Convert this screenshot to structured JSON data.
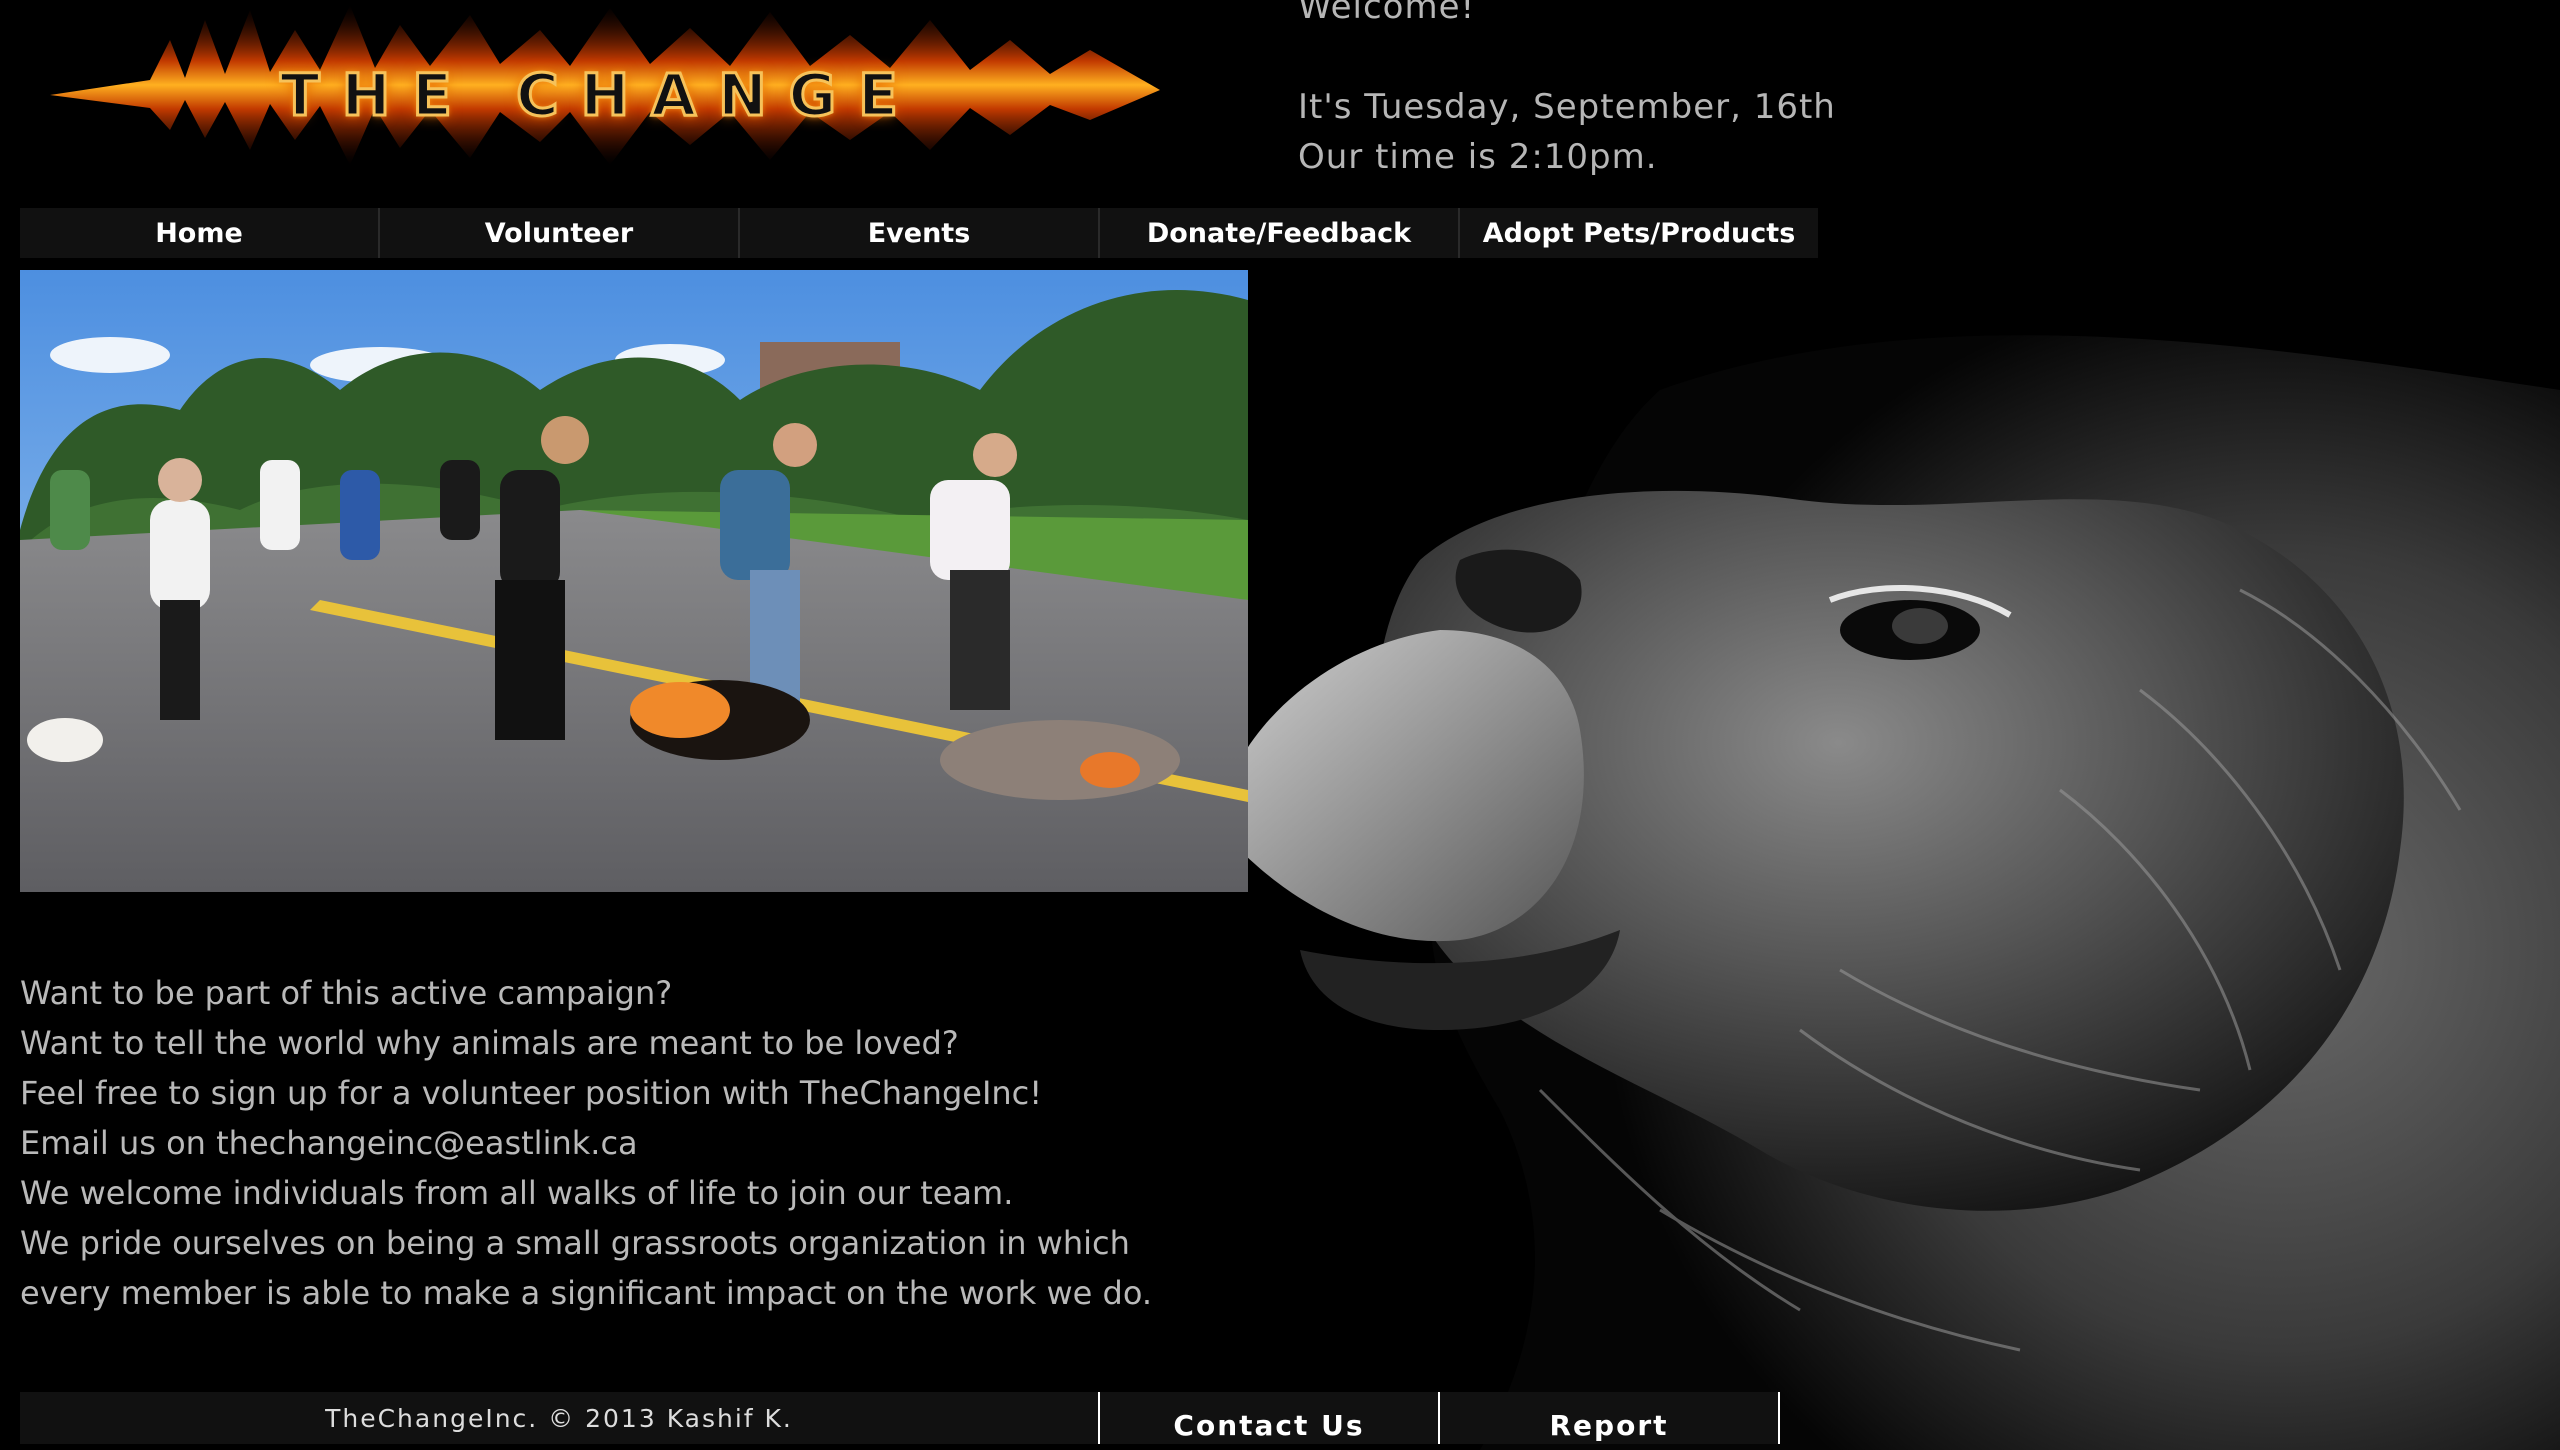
{
  "logo": {
    "text": "THE CHANGE"
  },
  "welcome": {
    "heading": "Welcome!",
    "date_line": "It's Tuesday, September, 16th",
    "time_line": "Our time is 2:10pm."
  },
  "nav": {
    "items": [
      {
        "label": "Home"
      },
      {
        "label": "Volunteer"
      },
      {
        "label": "Events"
      },
      {
        "label": "Donate/Feedback"
      },
      {
        "label": "Adopt Pets/Products"
      }
    ]
  },
  "main": {
    "paragraphs": [
      "Want to be part of this active campaign?",
      "Want to tell the world why animals are meant to be loved?",
      "Feel free to sign up for a volunteer position with TheChangeInc!",
      "Email us on thechangeinc@eastlink.ca",
      "We welcome individuals from all walks of life to join our team.",
      "We pride ourselves on being a small grassroots organization in which",
      "every member is able to make a significant impact on the work we do."
    ]
  },
  "footer": {
    "copyright": "TheChangeInc. © 2013 Kashif K.",
    "contact_label": "Contact Us",
    "report_label": "Report"
  },
  "colors": {
    "background": "#000000",
    "nav_bg": "#111111",
    "text_gray": "#b9b9b9",
    "logo_fire": "#ff8a1a"
  },
  "icons": {
    "logo_image": "fire-logo",
    "hero_photo": "dog-walk-photo",
    "background_image": "lion-portrait"
  }
}
